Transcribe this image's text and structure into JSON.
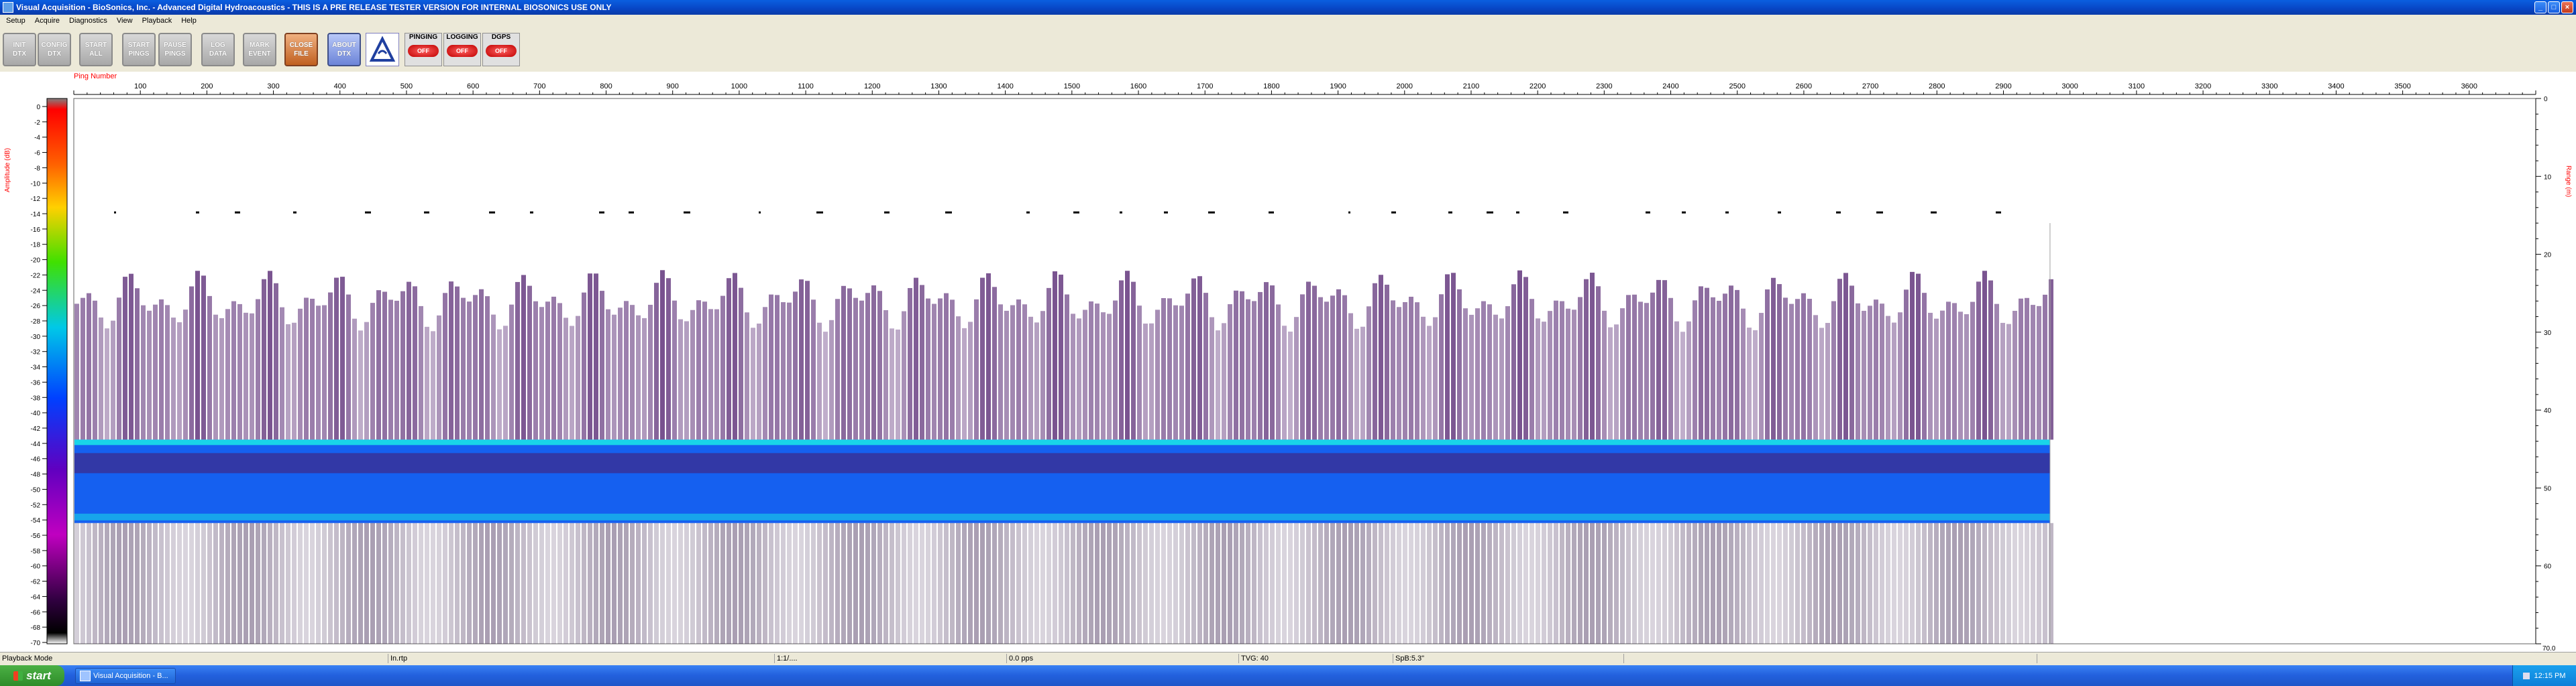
{
  "window": {
    "title": "Visual Acquisition  -  BioSonics, Inc.  -  Advanced Digital Hydroacoustics  -  THIS IS A PRE RELEASE TESTER VERSION FOR INTERNAL BIOSONICS USE ONLY"
  },
  "menu": [
    "Setup",
    "Acquire",
    "Diagnostics",
    "View",
    "Playback",
    "Help"
  ],
  "toolbar": {
    "buttons": [
      {
        "label": "INIT\nDTX"
      },
      {
        "label": "CONFIG\nDTX"
      },
      {
        "label": "START\nALL"
      },
      {
        "label": "START\nPINGS"
      },
      {
        "label": "PAUSE\nPINGS"
      },
      {
        "label": "LOG\nDATA"
      },
      {
        "label": "MARK\nEVENT"
      },
      {
        "label": "CLOSE\nFILE"
      },
      {
        "label": "ABOUT\nDTX"
      }
    ],
    "status": [
      {
        "label": "PINGING",
        "lamp": "OFF"
      },
      {
        "label": "LOGGING",
        "lamp": "OFF"
      },
      {
        "label": "DGPS",
        "lamp": "OFF"
      }
    ]
  },
  "echogram": {
    "x_axis_label": "Ping Number",
    "x_ticks": [
      100,
      200,
      300,
      400,
      500,
      600,
      700,
      800,
      900,
      1000,
      1100,
      1200,
      1300,
      1400,
      1500,
      1600,
      1700,
      1800,
      1900,
      2000,
      2100,
      2200,
      2300,
      2400,
      2500,
      2600,
      2700,
      2800,
      2900,
      3000,
      3100,
      3200,
      3300,
      3400,
      3500,
      3600
    ],
    "x_range": [
      0,
      3700
    ],
    "data_end_ping": 2970,
    "color_scale_label": "Amplitude (dB)",
    "color_scale_ticks": [
      0,
      -2,
      -4,
      -6,
      -8,
      -10,
      -12,
      -14,
      -16,
      -18,
      -20,
      -22,
      -24,
      -26,
      -28,
      -30,
      -32,
      -34,
      -36,
      -38,
      -40,
      -42,
      -44,
      -46,
      -48,
      -50,
      -52,
      -54,
      -56,
      -58,
      -60,
      -62,
      -64,
      -66,
      -68,
      -70
    ],
    "range_axis_label": "Range (m)",
    "range_ticks": [
      0,
      10,
      20,
      30,
      40,
      50,
      60
    ],
    "range_max_label": "70.0",
    "range_max": 70,
    "layers": {
      "surface_echo_range_m": 14.5,
      "noise_start_m": 16,
      "band_top_m": 43.8,
      "band_bottom_m": 54.5
    },
    "colors": {
      "accent_red": "#FF0000",
      "scatter": "#4B1869",
      "band_blue": "#1560F0",
      "band_cyan": "#19D4E8"
    }
  },
  "statusbar": {
    "mode": "Playback Mode",
    "file": "In.rtp",
    "time": "1:1/....",
    "rate": "0.0 pps",
    "tvg": "TVG: 40",
    "spb": "SpB:5.3\""
  },
  "taskbar": {
    "start_label": "start",
    "task_label": "Visual Acquisition  - B...",
    "clock": "12:15 PM"
  }
}
